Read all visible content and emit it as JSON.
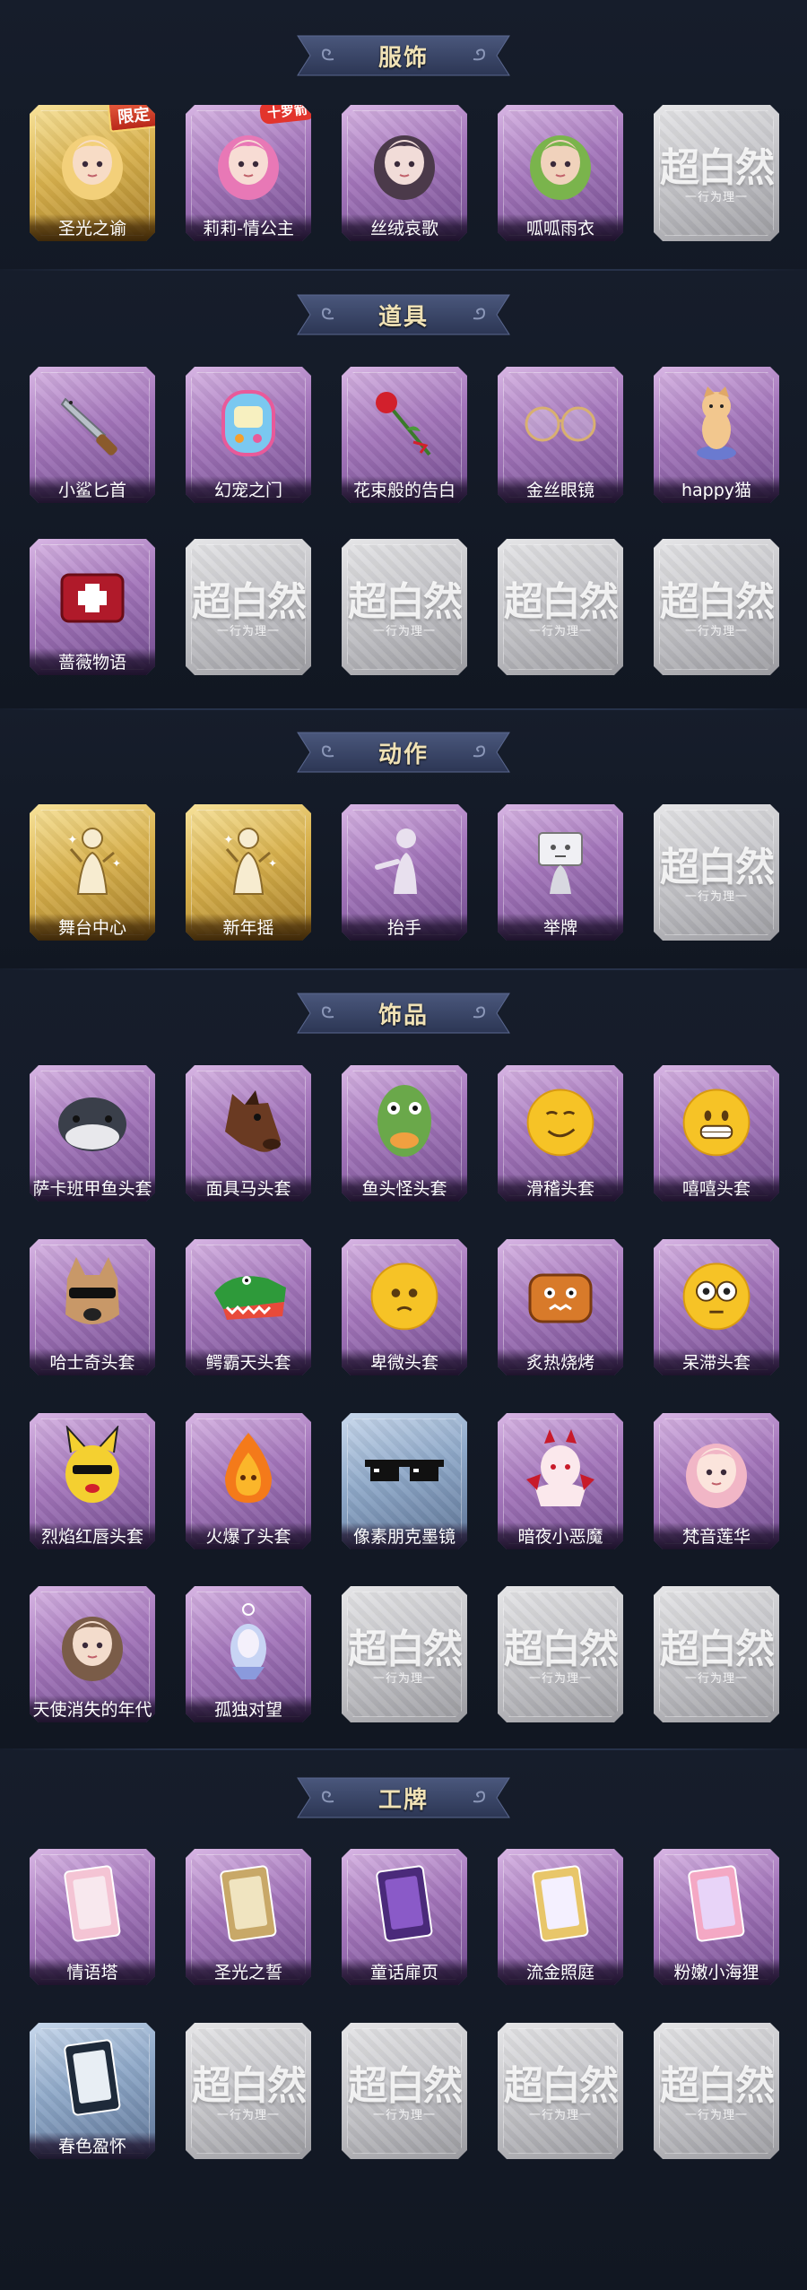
{
  "sections": [
    {
      "title": "服饰",
      "items": [
        {
          "label": "圣光之谕",
          "rarity": "gold",
          "icon": "golden-haired-girl-icon",
          "badge": "限定"
        },
        {
          "label": "莉莉-情公主",
          "rarity": "purple",
          "icon": "pink-haired-girl-icon",
          "badge": "十罗箭"
        },
        {
          "label": "丝绒哀歌",
          "rarity": "purple",
          "icon": "gothic-girl-icon"
        },
        {
          "label": "呱呱雨衣",
          "rarity": "purple",
          "icon": "frog-hood-girl-icon"
        },
        {
          "empty": true
        }
      ]
    },
    {
      "title": "道具",
      "items": [
        {
          "label": "小鲨匕首",
          "rarity": "purple",
          "icon": "shark-dagger-icon"
        },
        {
          "label": "幻宠之门",
          "rarity": "purple",
          "icon": "pet-gadget-icon"
        },
        {
          "label": "花束般的告白",
          "rarity": "purple",
          "icon": "rose-icon"
        },
        {
          "label": "金丝眼镜",
          "rarity": "purple",
          "icon": "glasses-icon"
        },
        {
          "label": "happy猫",
          "rarity": "purple",
          "icon": "dancing-cat-icon"
        },
        {
          "label": "蔷薇物语",
          "rarity": "purple",
          "icon": "red-box-icon"
        },
        {
          "empty": true
        },
        {
          "empty": true
        },
        {
          "empty": true
        },
        {
          "empty": true
        }
      ]
    },
    {
      "title": "动作",
      "items": [
        {
          "label": "舞台中心",
          "rarity": "gold",
          "icon": "pose-figure-icon"
        },
        {
          "label": "新年摇",
          "rarity": "gold",
          "icon": "pose-figure-icon"
        },
        {
          "label": "抬手",
          "rarity": "purple",
          "icon": "raise-hand-figure-icon"
        },
        {
          "label": "举牌",
          "rarity": "purple",
          "icon": "sign-holder-figure-icon"
        },
        {
          "empty": true
        }
      ]
    },
    {
      "title": "饰品",
      "items": [
        {
          "label": "萨卡班甲鱼头套",
          "rarity": "purple",
          "icon": "fish-head-icon"
        },
        {
          "label": "面具马头套",
          "rarity": "purple",
          "icon": "horse-head-icon"
        },
        {
          "label": "鱼头怪头套",
          "rarity": "purple",
          "icon": "green-fish-head-icon"
        },
        {
          "label": "滑稽头套",
          "rarity": "purple",
          "icon": "smirk-emoji-icon"
        },
        {
          "label": "嘻嘻头套",
          "rarity": "purple",
          "icon": "grin-emoji-icon"
        },
        {
          "label": "哈士奇头套",
          "rarity": "purple",
          "icon": "husky-head-icon"
        },
        {
          "label": "鳄霸天头套",
          "rarity": "purple",
          "icon": "crocodile-head-icon"
        },
        {
          "label": "卑微头套",
          "rarity": "purple",
          "icon": "pleading-emoji-icon"
        },
        {
          "label": "炙热烧烤",
          "rarity": "purple",
          "icon": "toast-head-icon"
        },
        {
          "label": "呆滞头套",
          "rarity": "purple",
          "icon": "dazed-emoji-icon"
        },
        {
          "label": "烈焰红唇头套",
          "rarity": "purple",
          "icon": "pikachu-hood-icon"
        },
        {
          "label": "火爆了头套",
          "rarity": "purple",
          "icon": "fire-spirit-icon"
        },
        {
          "label": "像素朋克墨镜",
          "rarity": "blue",
          "icon": "pixel-sunglasses-icon"
        },
        {
          "label": "暗夜小恶魔",
          "rarity": "purple",
          "icon": "little-devil-icon"
        },
        {
          "label": "梵音莲华",
          "rarity": "purple",
          "icon": "lotus-chibi-icon"
        },
        {
          "label": "天使消失的年代",
          "rarity": "purple",
          "icon": "angel-pendant-icon"
        },
        {
          "label": "孤独对望",
          "rarity": "purple",
          "icon": "crystal-pendant-icon"
        },
        {
          "empty": true
        },
        {
          "empty": true
        },
        {
          "empty": true
        }
      ]
    },
    {
      "title": "工牌",
      "items": [
        {
          "label": "情语塔",
          "rarity": "purple",
          "icon": "tower-card-icon"
        },
        {
          "label": "圣光之誓",
          "rarity": "purple",
          "icon": "holy-card-icon"
        },
        {
          "label": "童话扉页",
          "rarity": "purple",
          "icon": "fairytale-card-icon"
        },
        {
          "label": "流金照庭",
          "rarity": "purple",
          "icon": "gold-frame-card-icon"
        },
        {
          "label": "粉嫩小海狸",
          "rarity": "purple",
          "icon": "beaver-card-icon"
        },
        {
          "label": "春色盈怀",
          "rarity": "blue",
          "icon": "silhouette-card-icon"
        },
        {
          "empty": true
        },
        {
          "empty": true
        },
        {
          "empty": true
        },
        {
          "empty": true
        }
      ]
    }
  ],
  "placeholder": {
    "main": "超白然",
    "sub": "一行为理一"
  },
  "colors": {
    "background": "#141b28",
    "banner": "#3a4668",
    "banner_text": "#f0e2b6",
    "purple_card": "#a476bb",
    "gold_card": "#d9b24e",
    "blue_card": "#8ea8c8",
    "empty_card": "#c4c4c8"
  }
}
